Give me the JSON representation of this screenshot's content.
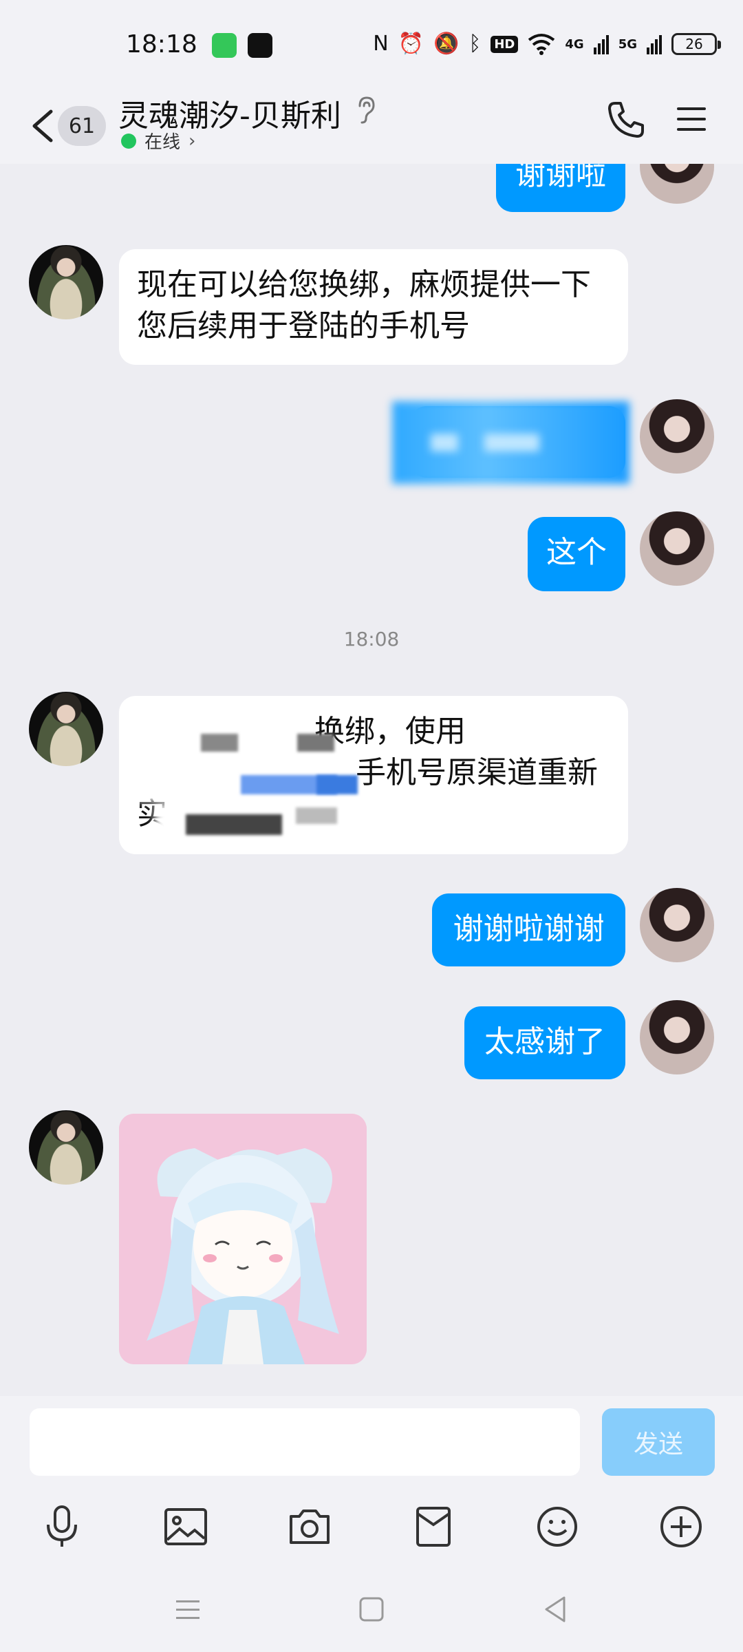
{
  "status_bar": {
    "time": "18:18",
    "battery": "26",
    "hd_label": "HD",
    "network_1": "4G",
    "network_2": "5G"
  },
  "header": {
    "unread_count": "61",
    "title": "灵魂潮汐-贝斯利",
    "status": "在线",
    "online_color": "#22c55e"
  },
  "messages": [
    {
      "side": "out",
      "text": "谢谢啦"
    },
    {
      "side": "in",
      "text": "现在可以给您换绑，麻烦提供一下您后续用于登陆的手机号"
    },
    {
      "side": "out",
      "text": "",
      "redacted": true
    },
    {
      "side": "out",
      "text": "这个"
    },
    {
      "side": "divider",
      "text": "18:08"
    },
    {
      "side": "in",
      "line1": "换绑，使用",
      "line2": "手机号原渠道重新",
      "line3": "实",
      "redacted": true
    },
    {
      "side": "out",
      "text": "谢谢啦谢谢"
    },
    {
      "side": "out",
      "text": "太感谢了"
    },
    {
      "side": "in",
      "sticker": true
    }
  ],
  "input": {
    "value": "",
    "send_label": "发送"
  },
  "toolbar": {
    "icons": [
      "microphone-icon",
      "image-icon",
      "camera-icon",
      "red-packet-icon",
      "emoji-icon",
      "plus-icon"
    ]
  },
  "colors": {
    "accent": "#0099ff",
    "send_disabled": "#87cdfb",
    "background": "#ededf2"
  }
}
